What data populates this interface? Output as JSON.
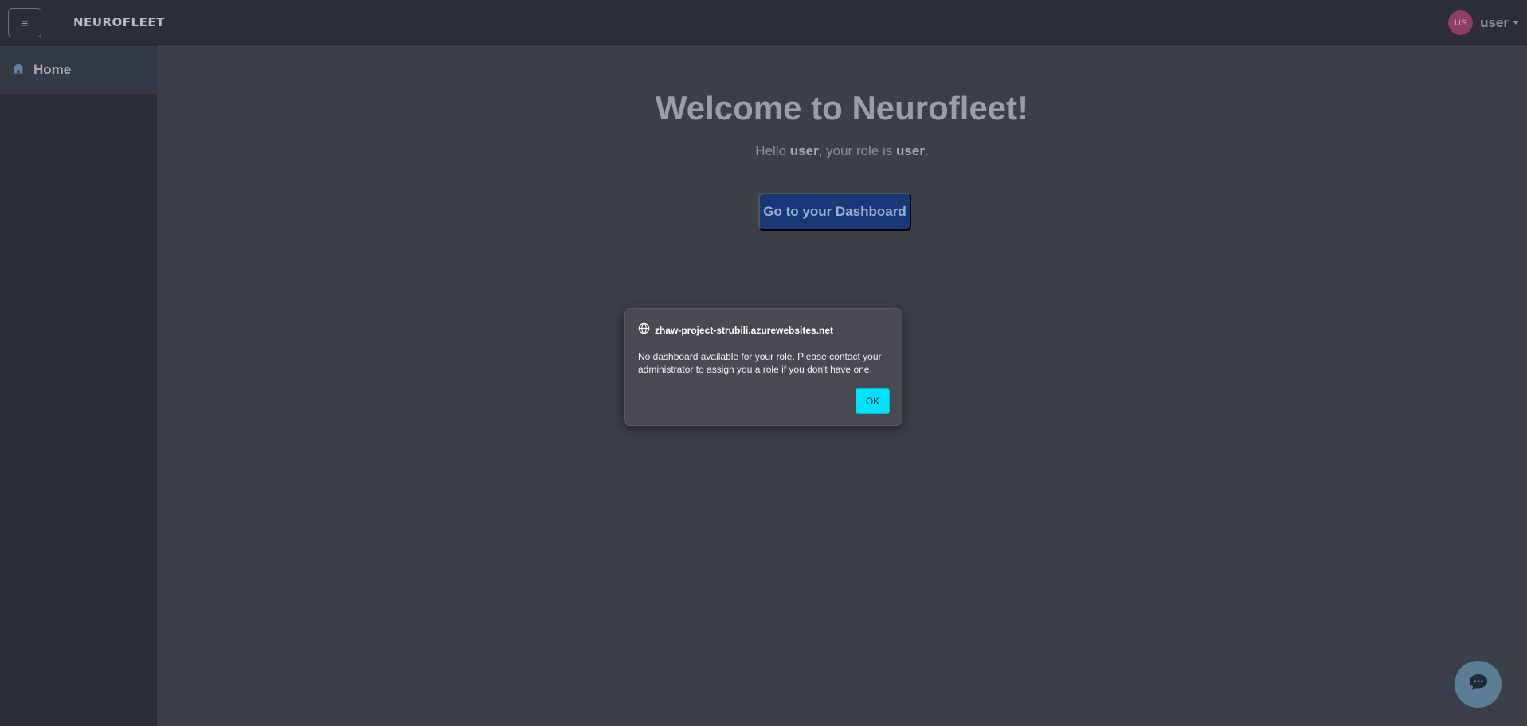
{
  "header": {
    "menu_icon": "hamburger-icon",
    "logo_text": "NEUROFLEET",
    "user": {
      "avatar_initials": "US",
      "name": "user"
    }
  },
  "sidebar": {
    "items": [
      {
        "label": "Home",
        "icon": "home-icon"
      }
    ]
  },
  "main": {
    "title": "Welcome to Neurofleet!",
    "greeting": {
      "hello": "Hello",
      "username": "user",
      "middle": ", your role is",
      "role": "user",
      "end": "."
    },
    "dashboard_button": "Go to your Dashboard"
  },
  "dialog": {
    "origin": "zhaw-project-strubili.azurewebsites.net",
    "message": "No dashboard available for your role. Please contact your administrator to assign you a role if you don't have one.",
    "ok_label": "OK"
  },
  "chat": {
    "icon": "chat-bubble-icon"
  },
  "colors": {
    "page_bg": "#3b3f49",
    "header_bg": "#2c2f36",
    "sidebar_bg": "#2b2e35",
    "primary_button": "#163a78",
    "ok_button": "#00e0ff",
    "avatar_bg": "#8d3e64",
    "chat_button": "#5b7d94"
  }
}
